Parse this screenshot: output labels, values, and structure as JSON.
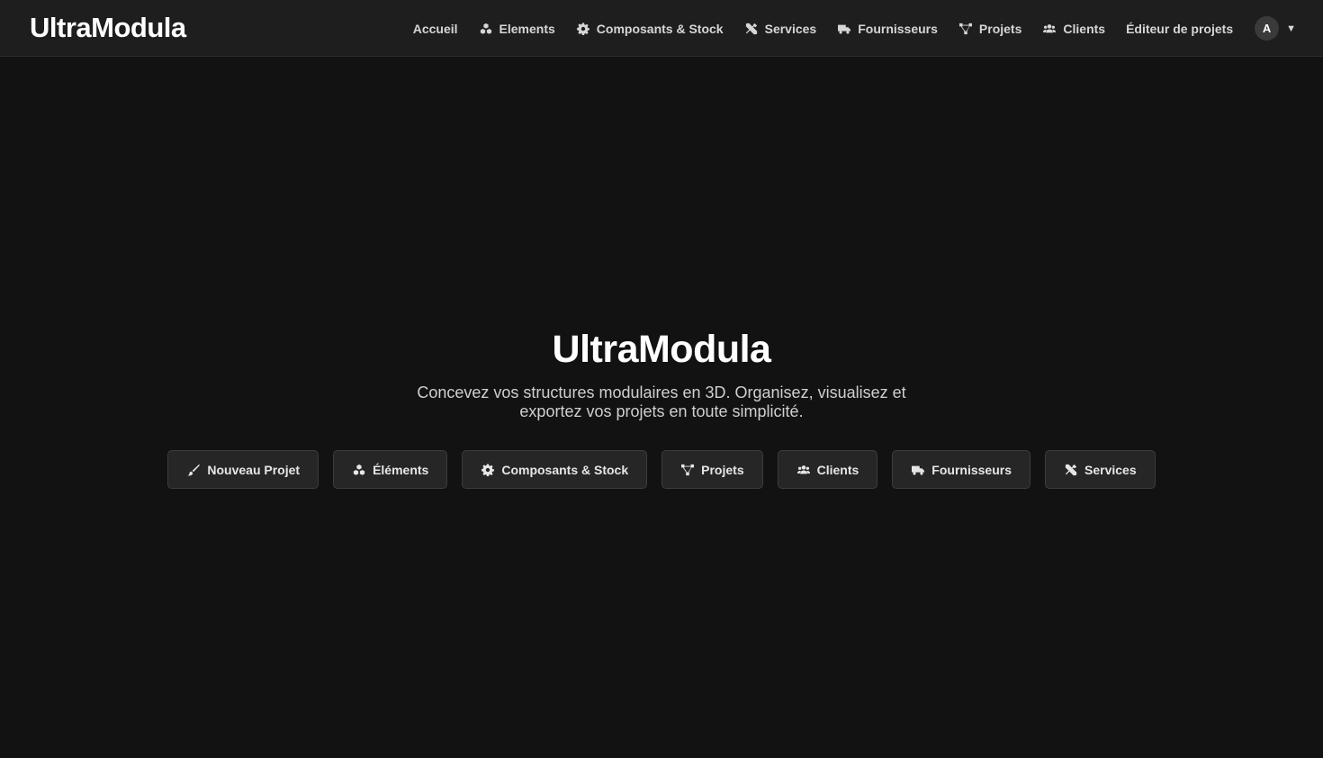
{
  "navbar": {
    "brand": "UltraModula",
    "links": [
      {
        "label": "Accueil",
        "icon": ""
      },
      {
        "label": "Elements",
        "icon": "cubes-icon"
      },
      {
        "label": "Composants & Stock",
        "icon": "gear-icon"
      },
      {
        "label": "Services",
        "icon": "tools-icon"
      },
      {
        "label": "Fournisseurs",
        "icon": "truck-icon"
      },
      {
        "label": "Projets",
        "icon": "nodes-icon"
      },
      {
        "label": "Clients",
        "icon": "users-icon"
      },
      {
        "label": "Éditeur de projets",
        "icon": ""
      }
    ],
    "avatar_initial": "A"
  },
  "hero": {
    "title": "UltraModula",
    "subtitle": "Concevez vos structures modulaires en 3D. Organisez, visualisez et exportez vos projets en toute simplicité.",
    "buttons": [
      {
        "label": "Nouveau Projet",
        "icon": "brush-icon"
      },
      {
        "label": "Éléments",
        "icon": "cubes-icon"
      },
      {
        "label": "Composants & Stock",
        "icon": "gear-icon"
      },
      {
        "label": "Projets",
        "icon": "nodes-icon"
      },
      {
        "label": "Clients",
        "icon": "users-icon"
      },
      {
        "label": "Fournisseurs",
        "icon": "truck-icon"
      },
      {
        "label": "Services",
        "icon": "tools-icon"
      }
    ]
  },
  "colors": {
    "background": "#121212",
    "navbar": "#1e1e1e",
    "button": "#262626",
    "text": "#ffffff"
  }
}
